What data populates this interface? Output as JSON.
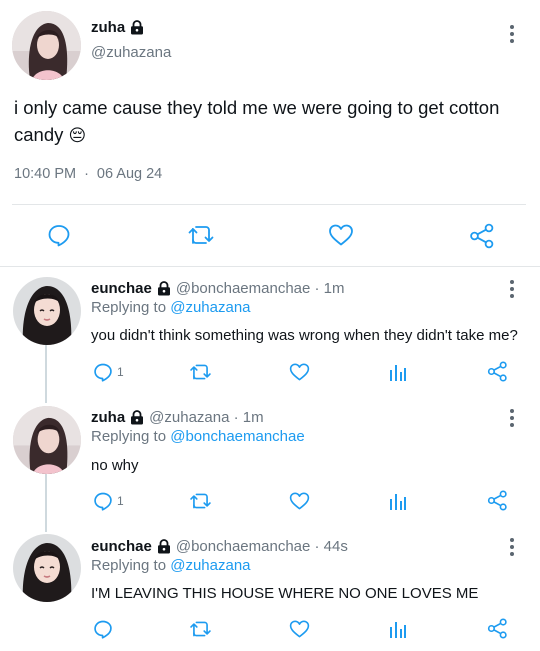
{
  "main_tweet": {
    "display_name": "zuha",
    "handle": "@zuhazana",
    "text": "i only came cause they told me we were going to get cotton candy",
    "emoji": "😔",
    "time": "10:40 PM",
    "separator": "·",
    "date": "06 Aug 24"
  },
  "replies": [
    {
      "display_name": "eunchae",
      "handle_time": "@bonchaemanchae · 1m",
      "replying_prefix": "Replying to",
      "replying_to": "@zuhazana",
      "text": "you didn't think something was wrong when they didn't take me?",
      "reply_count": "1"
    },
    {
      "display_name": "zuha",
      "handle_time": "@zuhazana · 1m",
      "replying_prefix": "Replying to",
      "replying_to": "@bonchaemanchae",
      "text": "no why",
      "reply_count": "1"
    },
    {
      "display_name": "eunchae",
      "handle_time": "@bonchaemanchae · 44s",
      "replying_prefix": "Replying to",
      "replying_to": "@zuhazana",
      "text": "I'M LEAVING THIS HOUSE WHERE NO ONE LOVES ME",
      "reply_count": ""
    }
  ],
  "icons": {
    "reply": "reply-icon",
    "retweet": "retweet-icon",
    "like": "like-icon",
    "analytics": "analytics-icon",
    "share": "share-icon",
    "lock": "lock-icon",
    "more": "more-options-icon"
  },
  "colors": {
    "link": "#1d9bf0",
    "muted": "#6b7680",
    "text": "#0f1419",
    "divider": "#e3e6e8"
  }
}
